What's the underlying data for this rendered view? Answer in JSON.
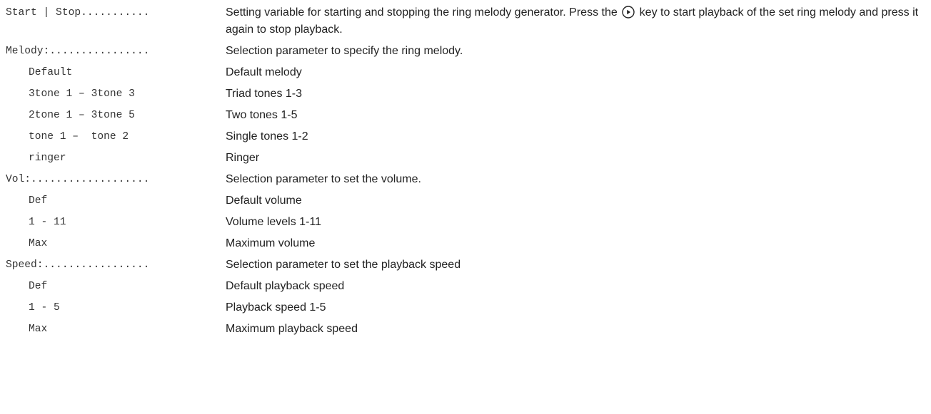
{
  "entries": [
    {
      "term": "Start | Stop...........",
      "description_before_icon": "Setting variable for starting and stopping the ring melody generator. Press the",
      "icon": "play-key-icon",
      "description_after_icon": "key to start playback of the set ring melody and press it again to stop playback."
    },
    {
      "term": "Melody:................",
      "description": "Selection parameter to specify the ring melody.",
      "options": [
        {
          "value": "Default",
          "description": "Default melody"
        },
        {
          "value": "3tone 1 – 3tone 3",
          "description": "Triad tones 1-3"
        },
        {
          "value": "2tone 1 – 3tone 5",
          "description": "Two tones 1-5"
        },
        {
          "value": "tone 1 –  tone 2",
          "description": "Single tones 1-2"
        },
        {
          "value": "ringer",
          "description": "Ringer"
        }
      ]
    },
    {
      "term": "Vol:...................",
      "description": "Selection parameter to set the volume.",
      "options": [
        {
          "value": "Def",
          "description": "Default volume"
        },
        {
          "value": "1 - 11",
          "description": "Volume levels 1-11"
        },
        {
          "value": "Max",
          "description": "Maximum volume"
        }
      ]
    },
    {
      "term": "Speed:.................",
      "description": "Selection parameter to set the playback speed",
      "options": [
        {
          "value": "Def",
          "description": "Default playback speed"
        },
        {
          "value": "1 - 5",
          "description": "Playback speed 1-5"
        },
        {
          "value": "Max",
          "description": "Maximum playback speed"
        }
      ]
    }
  ]
}
